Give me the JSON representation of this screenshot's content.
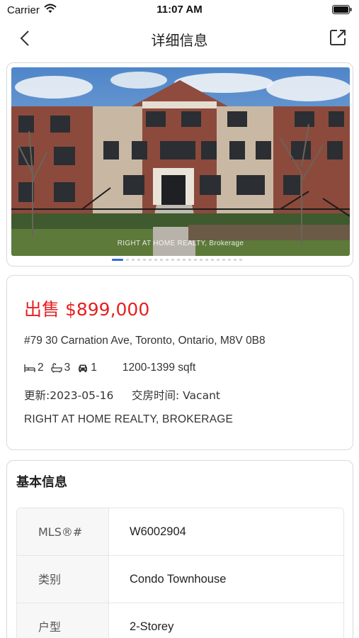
{
  "status_bar": {
    "carrier": "Carrier",
    "time": "11:07 AM"
  },
  "nav": {
    "title": "详细信息",
    "back_icon": "chevron-left-icon",
    "share_icon": "share-icon"
  },
  "photo": {
    "watermark": "RIGHT AT HOME REALTY, Brokerage",
    "page_count": 22,
    "active_index": 0
  },
  "listing": {
    "price": "出售 $899,000",
    "address": "#79 30 Carnation Ave, Toronto, Ontario, M8V 0B8",
    "beds": "2",
    "baths": "3",
    "parking": "1",
    "sqft": "1200-1399 sqft",
    "updated": "更新:2023-05-16",
    "possession": "交房时间: Vacant",
    "brokerage": "RIGHT AT HOME REALTY, BROKERAGE"
  },
  "basic_info": {
    "title": "基本信息",
    "rows": [
      {
        "label": "MLS®#",
        "value": "W6002904"
      },
      {
        "label": "类别",
        "value": "Condo Townhouse"
      },
      {
        "label": "户型",
        "value": "2-Storey"
      }
    ]
  },
  "colors": {
    "price": "#e62020",
    "accent": "#2f6fd6"
  }
}
